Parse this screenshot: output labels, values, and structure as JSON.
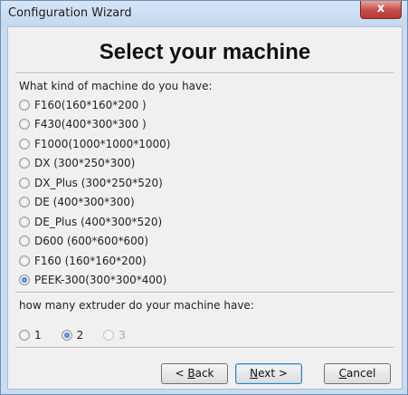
{
  "window": {
    "title": "Configuration Wizard",
    "close_glyph": "x"
  },
  "heading": "Select your machine",
  "machine": {
    "question": "What kind of machine do you have:",
    "options": [
      {
        "label": "F160(160*160*200 )",
        "checked": false
      },
      {
        "label": "F430(400*300*300 )",
        "checked": false
      },
      {
        "label": "F1000(1000*1000*1000)",
        "checked": false
      },
      {
        "label": "DX (300*250*300)",
        "checked": false
      },
      {
        "label": "DX_Plus (300*250*520)",
        "checked": false
      },
      {
        "label": "DE (400*300*300)",
        "checked": false
      },
      {
        "label": "DE_Plus (400*300*520)",
        "checked": false
      },
      {
        "label": "D600 (600*600*600)",
        "checked": false
      },
      {
        "label": "F160 (160*160*200)",
        "checked": false
      },
      {
        "label": "PEEK-300(300*300*400)",
        "checked": true
      }
    ]
  },
  "extruder": {
    "question": "how many extruder do your machine have:",
    "options": [
      {
        "label": "1",
        "checked": false,
        "disabled": false
      },
      {
        "label": "2",
        "checked": true,
        "disabled": false
      },
      {
        "label": "3",
        "checked": false,
        "disabled": true
      }
    ]
  },
  "buttons": {
    "back": {
      "prefix": "< ",
      "mnemonic": "B",
      "rest": "ack"
    },
    "next": {
      "mnemonic": "N",
      "rest": "ext >"
    },
    "cancel": {
      "mnemonic": "C",
      "rest": "ancel"
    }
  }
}
